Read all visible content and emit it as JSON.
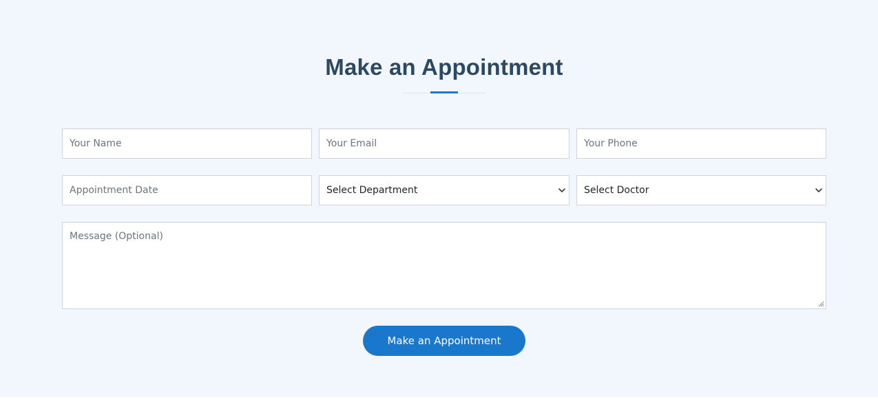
{
  "section": {
    "title": "Make an Appointment"
  },
  "form": {
    "name_placeholder": "Your Name",
    "email_placeholder": "Your Email",
    "phone_placeholder": "Your Phone",
    "date_placeholder": "Appointment Date",
    "department_selected": "Select Department",
    "doctor_selected": "Select Doctor",
    "message_placeholder": "Message (Optional)",
    "submit_label": "Make an Appointment"
  },
  "colors": {
    "background": "#f1f7fd",
    "heading": "#2c4964",
    "accent": "#1977cc",
    "field_border": "#ced4da"
  },
  "icons": {
    "select_arrow": "chevron-down-icon",
    "textarea_resize": "resize-grip-icon"
  }
}
